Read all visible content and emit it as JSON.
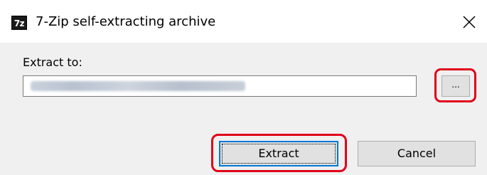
{
  "window": {
    "title": "7-Zip self-extracting archive",
    "icon_text": "7z",
    "close_label": "×"
  },
  "form": {
    "extract_to_label": "Extract to:",
    "path_value_obscured": true
  },
  "buttons": {
    "browse_label": "...",
    "extract_label": "Extract",
    "cancel_label": "Cancel"
  },
  "colors": {
    "highlight": "#e0001a",
    "focus_border": "#0078d7",
    "button_face": "#e1e1e1",
    "dialog_background": "#f0f0f0"
  },
  "icons": [
    "app-7zip-icon",
    "close-icon"
  ]
}
